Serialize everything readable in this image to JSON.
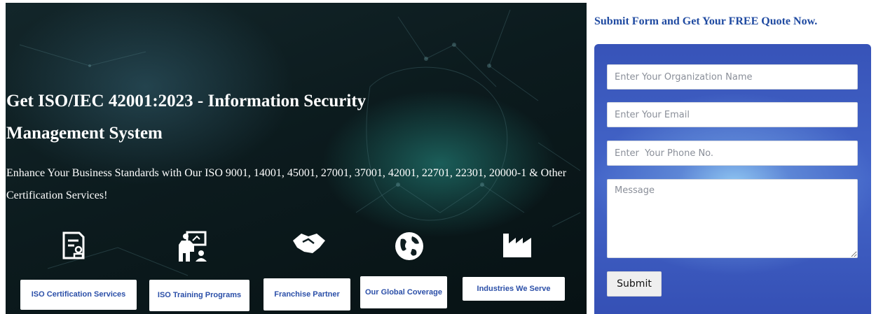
{
  "hero": {
    "title": "Get ISO/IEC 42001:2023 - Information Security Management System",
    "subtitle": "Enhance Your Business Standards with Our ISO 9001, 14001, 45001, 27001, 37001, 42001, 22701, 22301, 20000-1 & Other Certification Services!",
    "features": [
      {
        "icon": "certificate-document-icon",
        "label": "ISO Certification Services"
      },
      {
        "icon": "training-presentation-icon",
        "label": "ISO Training Programs"
      },
      {
        "icon": "handshake-icon",
        "label": "Franchise Partner"
      },
      {
        "icon": "globe-icon",
        "label": "Our Global Coverage"
      },
      {
        "icon": "factory-icon",
        "label": "Industries We Serve"
      }
    ]
  },
  "form": {
    "heading": "Submit Form and Get Your FREE Quote Now.",
    "organization_placeholder": "Enter Your Organization Name",
    "email_placeholder": "Enter Your Email",
    "phone_placeholder": "Enter  Your Phone No.",
    "message_placeholder": "Message",
    "submit_label": "Submit"
  },
  "colors": {
    "heading": "#1f4aa1",
    "button_text": "#2b4fa8",
    "panel": "#3a56b9"
  }
}
